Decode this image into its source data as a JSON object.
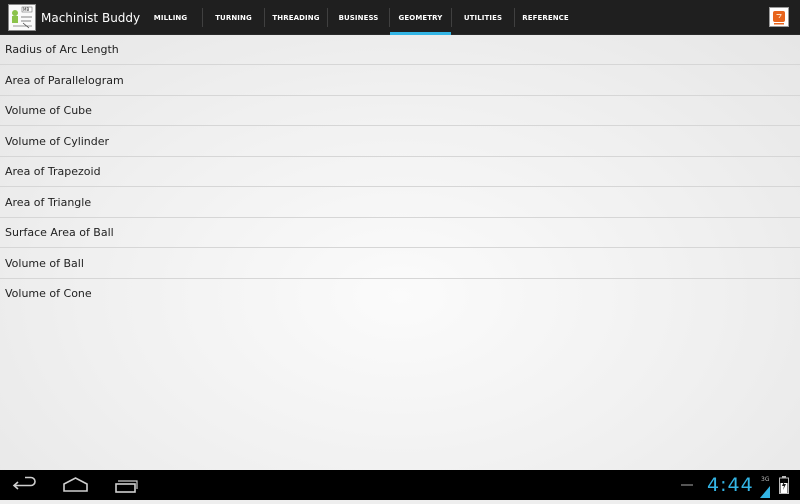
{
  "app": {
    "title": "Machinist Buddy",
    "icon": "machinist-buddy-logo"
  },
  "tabs": [
    {
      "label": "MILLING",
      "selected": false
    },
    {
      "label": "TURNING",
      "selected": false
    },
    {
      "label": "THREADING",
      "selected": false
    },
    {
      "label": "BUSINESS",
      "selected": false
    },
    {
      "label": "GEOMETRY",
      "selected": true
    },
    {
      "label": "UTILITIES",
      "selected": false
    },
    {
      "label": "REFERENCE",
      "selected": false
    }
  ],
  "colors": {
    "accent": "#33b5e5",
    "actionbar": "#1f1f1f",
    "overflow": "#e8641c"
  },
  "list": {
    "items": [
      "Radius of Arc Length",
      "Area of Parallelogram",
      "Volume of Cube",
      "Volume of Cylinder",
      "Area of Trapezoid",
      "Area of Triangle",
      "Surface Area of Ball",
      "Volume of Ball",
      "Volume of Cone"
    ]
  },
  "status": {
    "time": "4:44",
    "network": "3G"
  }
}
